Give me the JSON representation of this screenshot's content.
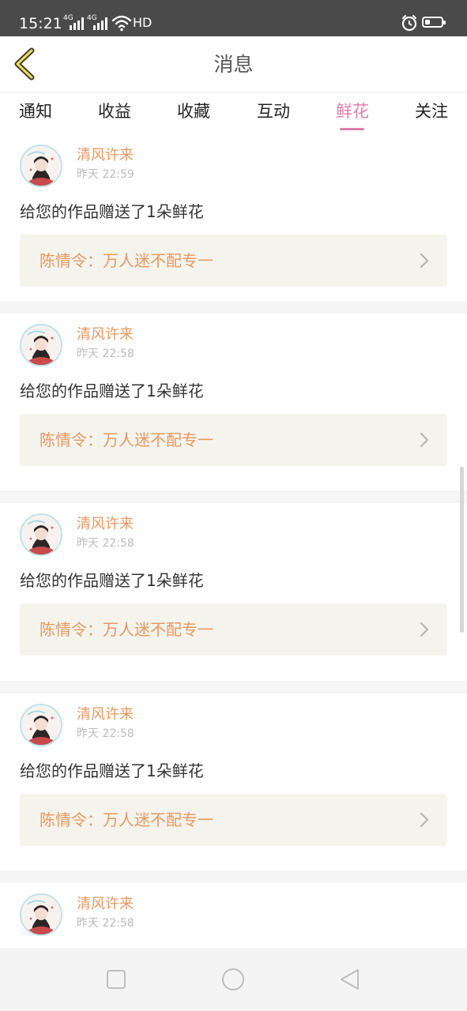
{
  "status_bar": {
    "time": "15:21",
    "network_1": "4G",
    "network_2": "4G",
    "hd": "HD",
    "battery_level": 0.3,
    "icons": [
      "signal-icon",
      "signal-icon",
      "wifi-icon",
      "alarm-icon",
      "battery-icon"
    ]
  },
  "header": {
    "title": "消息",
    "back_icon": "chevron-left-icon"
  },
  "tabs": [
    {
      "label": "通知",
      "active": false
    },
    {
      "label": "收益",
      "active": false
    },
    {
      "label": "收藏",
      "active": false
    },
    {
      "label": "互动",
      "active": false
    },
    {
      "label": "鲜花",
      "active": true
    },
    {
      "label": "关注",
      "active": false
    }
  ],
  "messages": [
    {
      "user": "清风许来",
      "time": "昨天 22:59",
      "text": "给您的作品赠送了1朵鲜花",
      "work": "陈情令：万人迷不配专一"
    },
    {
      "user": "清风许来",
      "time": "昨天 22:58",
      "text": "给您的作品赠送了1朵鲜花",
      "work": "陈情令：万人迷不配专一"
    },
    {
      "user": "清风许来",
      "time": "昨天 22:58",
      "text": "给您的作品赠送了1朵鲜花",
      "work": "陈情令：万人迷不配专一"
    },
    {
      "user": "清风许来",
      "time": "昨天 22:58",
      "text": "给您的作品赠送了1朵鲜花",
      "work": "陈情令：万人迷不配专一"
    },
    {
      "user": "清风许来",
      "time": "昨天 22:58",
      "text": "",
      "work": ""
    }
  ],
  "nav_bar": {
    "icons": [
      "recent-apps-icon",
      "home-icon",
      "back-triangle-icon"
    ]
  },
  "colors": {
    "accent": "#e17fab",
    "username": "#e8975f",
    "link_bg": "#f4f4ed",
    "status_bar": "#4a4a4a"
  }
}
